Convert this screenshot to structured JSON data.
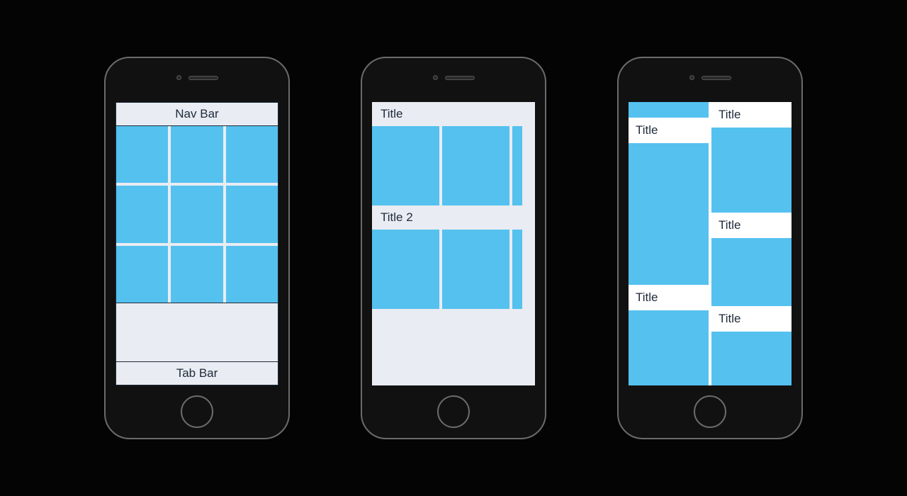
{
  "phone1": {
    "nav_label": "Nav Bar",
    "tab_label": "Tab Bar",
    "grid_cells": 9
  },
  "phone2": {
    "sections": [
      {
        "title": "Title"
      },
      {
        "title": "Title 2"
      }
    ]
  },
  "phone3": {
    "left_titles": [
      "Title",
      "Title"
    ],
    "right_titles": [
      "Title",
      "Title",
      "Title"
    ]
  },
  "colors": {
    "tile": "#55c1ef",
    "screen_bg": "#e9ecf2",
    "text": "#1e2a3a"
  }
}
